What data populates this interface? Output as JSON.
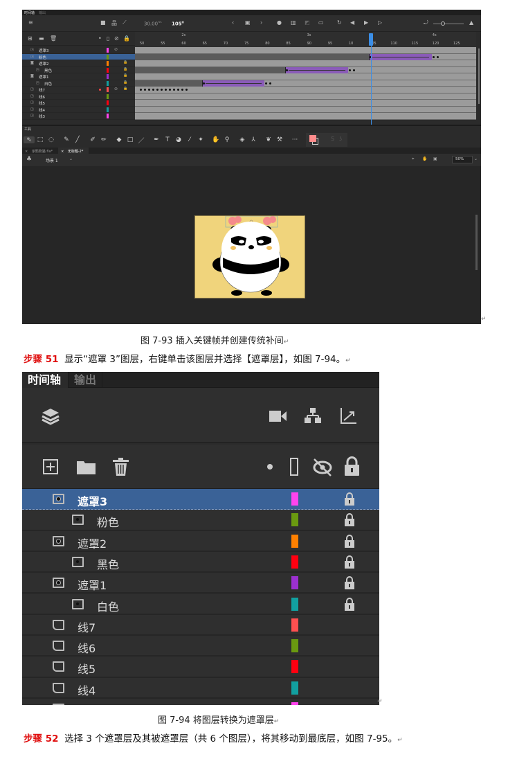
{
  "figure1": {
    "tabs": [
      "时间轴",
      "输出"
    ],
    "fps": "30.00",
    "fps_unit": "FPS",
    "current_frame": "105",
    "frame_unit": "帧",
    "ruler_frames": [
      "50",
      "55",
      "60",
      "65",
      "70",
      "75",
      "80",
      "85",
      "90",
      "95",
      "10",
      "105",
      "110",
      "115",
      "120",
      "125"
    ],
    "ruler_seconds": [
      {
        "label": "2s",
        "frame": 60
      },
      {
        "label": "3s",
        "frame": 90
      },
      {
        "label": "4s",
        "frame": 120
      }
    ],
    "playhead_frame": 105,
    "layers": [
      {
        "name": "遮罩3",
        "type": "normal",
        "color": "#ff44ee",
        "hidden": true,
        "lock": false,
        "indent": false,
        "dark_until": null,
        "tween": null
      },
      {
        "name": "粉色",
        "type": "normal",
        "color": "#6a9a10",
        "hidden": false,
        "lock": false,
        "indent": false,
        "selected": true,
        "dark_until": 105,
        "tween": [
          105,
          120
        ]
      },
      {
        "name": "遮罩2",
        "type": "mask",
        "color": "#ff8000",
        "hidden": false,
        "lock": true,
        "indent": false,
        "dark_until": null,
        "tween": null
      },
      {
        "name": "黑色",
        "type": "masked",
        "color": "#ff0010",
        "hidden": false,
        "lock": true,
        "indent": true,
        "dark_until": 85,
        "tween": [
          85,
          100
        ]
      },
      {
        "name": "遮罩1",
        "type": "mask",
        "color": "#9b30d0",
        "hidden": false,
        "lock": true,
        "indent": false,
        "dark_until": null,
        "tween": null
      },
      {
        "name": "白色",
        "type": "masked",
        "color": "#12a0a0",
        "hidden": false,
        "lock": true,
        "indent": true,
        "dark_until": 65,
        "tween": [
          65,
          80
        ]
      },
      {
        "name": "线7",
        "type": "normal",
        "color": "#ff5050",
        "hidden": true,
        "lock": true,
        "dot": true,
        "indent": false,
        "dark_until": null,
        "tween": null,
        "keyframes": [
          50,
          51,
          52,
          53,
          54,
          55,
          56,
          57,
          58,
          59,
          60,
          61
        ]
      },
      {
        "name": "线6",
        "type": "normal",
        "color": "#6a9a10",
        "indent": false
      },
      {
        "name": "线5",
        "type": "normal",
        "color": "#ff0010",
        "indent": false
      },
      {
        "name": "线4",
        "type": "normal",
        "color": "#12a0a0",
        "indent": false
      },
      {
        "name": "线3",
        "type": "normal",
        "color": "#ff44ee",
        "indent": false
      }
    ],
    "tools_label": "工具",
    "tools": [
      "selection",
      "free-transform",
      "lasso",
      "paint-brush",
      "brush",
      "fluid-brush",
      "pencil",
      "eraser",
      "rectangle",
      "line",
      "pen",
      "text",
      "paint-bucket",
      "eyedropper",
      "pin",
      "hand",
      "zoom",
      "camera",
      "bone-bind",
      "asset-warp",
      "bone",
      "more"
    ],
    "stroke_color": "#333333",
    "fill_color": "#ff8c8c",
    "doc_tabs": [
      "涂鸦熊猫.fla*",
      "无标题-2*"
    ],
    "scene": "场景 1",
    "zoom": "50%",
    "stage_color": "#f0d47c",
    "caption": "图 7-93  插入关键帧并创建传统补间"
  },
  "step51": {
    "label": "步骤 51",
    "text": "显示“遮罩 3”图层，右键单击该图层并选择【遮罩层】，如图 7-94。"
  },
  "figure2": {
    "tabs": [
      "时间轴",
      "输出"
    ],
    "layers": [
      {
        "name": "遮罩3",
        "type": "mask",
        "color": "#ff44ee",
        "lock": true,
        "indent": false,
        "selected": true
      },
      {
        "name": "粉色",
        "type": "masked",
        "color": "#6a9a10",
        "lock": true,
        "indent": true
      },
      {
        "name": "遮罩2",
        "type": "mask",
        "color": "#ff8000",
        "lock": true,
        "indent": false
      },
      {
        "name": "黑色",
        "type": "masked",
        "color": "#ff0010",
        "lock": true,
        "indent": true
      },
      {
        "name": "遮罩1",
        "type": "mask",
        "color": "#9b30d0",
        "lock": true,
        "indent": false
      },
      {
        "name": "白色",
        "type": "masked",
        "color": "#12a0a0",
        "lock": true,
        "indent": true
      },
      {
        "name": "线7",
        "type": "normal",
        "color": "#ff5050",
        "lock": false,
        "indent": false
      },
      {
        "name": "线6",
        "type": "normal",
        "color": "#6a9a10",
        "lock": false,
        "indent": false
      },
      {
        "name": "线5",
        "type": "normal",
        "color": "#ff0010",
        "lock": false,
        "indent": false
      },
      {
        "name": "线4",
        "type": "normal",
        "color": "#12a0a0",
        "lock": false,
        "indent": false
      },
      {
        "name": "",
        "type": "normal",
        "color": "#ff44ee",
        "lock": false,
        "indent": false
      }
    ],
    "caption": "图 7-94  将图层转换为遮罩层"
  },
  "step52": {
    "label": "步骤 52",
    "text": "选择 3 个遮罩层及其被遮罩层（共 6 个图层），将其移动到最底层，如图 7-95。"
  },
  "accent_color": "#3a6297"
}
